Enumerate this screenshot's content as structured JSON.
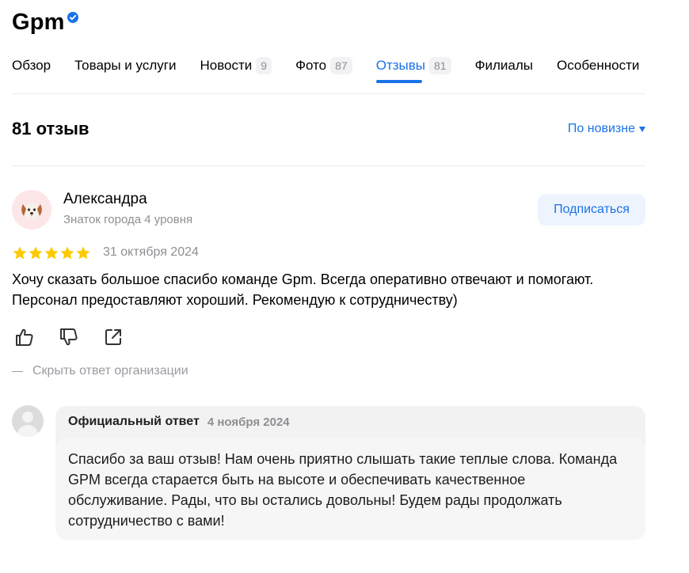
{
  "org": {
    "name": "Gpm",
    "verified_icon": "verified-check-icon",
    "accent_color": "#1a73e8"
  },
  "tabs": [
    {
      "label": "Обзор"
    },
    {
      "label": "Товары и услуги"
    },
    {
      "label": "Новости",
      "count": "9"
    },
    {
      "label": "Фото",
      "count": "87"
    },
    {
      "label": "Отзывы",
      "count": "81",
      "active": true
    },
    {
      "label": "Филиалы"
    },
    {
      "label": "Особенности"
    }
  ],
  "reviews": {
    "count_label": "81 отзыв",
    "sort_label": "По новизне"
  },
  "review": {
    "author": "Александра",
    "author_level": "Знаток города 4 уровня",
    "subscribe_label": "Подписаться",
    "rating": 5,
    "rating_max": 5,
    "star_color": "#fcca00",
    "date": "31 октября 2024",
    "text": "Хочу сказать большое спасибо команде Gpm. Всегда оперативно отвечают и помогают. Персонал предоставляют хороший. Рекомендую к сотрудничеству)",
    "actions": [
      "like-icon",
      "dislike-icon",
      "share-icon"
    ],
    "hide_reply_label": "Скрыть ответ организации"
  },
  "reply": {
    "label": "Официальный ответ",
    "date": "4 ноября 2024",
    "text": "Спасибо за ваш отзыв! Нам очень приятно слышать такие теплые слова. Команда GPM всегда старается быть на высоте и обеспечивать качественное обслуживание. Рады, что вы остались довольны! Будем рады продолжать сотрудничество с вами!"
  }
}
